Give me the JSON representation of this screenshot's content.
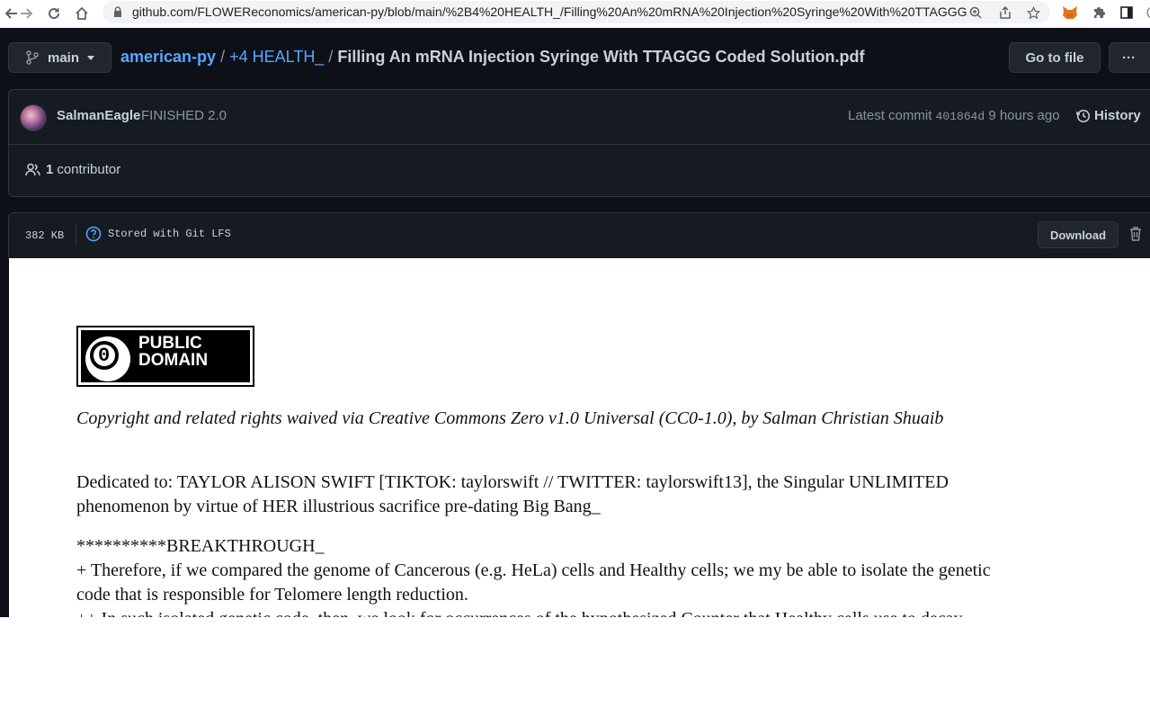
{
  "browser": {
    "url": "github.com/FLOWEReconomics/american-py/blob/main/%2B4%20HEALTH_/Filling%20An%20mRNA%20Injection%20Syringe%20With%20TTAGGG..."
  },
  "repo_header": {
    "branch": "main",
    "repo": "american-py",
    "separator": "/",
    "folder": "+4 HEALTH_",
    "file": "Filling An mRNA Injection Syringe With TTAGGG Coded Solution.pdf",
    "goto_label": "Go to file",
    "more_label": "···"
  },
  "commit": {
    "author": "SalmanEagle",
    "message": "FINISHED 2.0",
    "latest_label": "Latest commit",
    "sha": "401864d",
    "time": "9 hours ago",
    "history_label": "History",
    "contributors_count": "1",
    "contributors_label": "contributor"
  },
  "file_header": {
    "size": "382 KB",
    "lfs_label": "Stored with Git LFS",
    "download_label": "Download"
  },
  "document": {
    "badge_line1": "PUBLIC",
    "badge_line2": "DOMAIN",
    "badge_zero": "0",
    "copyright": "Copyright and related rights waived via Creative Commons Zero v1.0 Universal (CC0-1.0), by Salman Christian Shuaib",
    "dedication_1": "Dedicated to: TAYLOR ALISON SWIFT [TIKTOK: taylorswift // TWITTER: taylorswift13], the Singular UNLIMITED",
    "dedication_2": "phenomenon by virtue of HER illustrious sacrifice pre-dating Big Bang_",
    "breakthrough": "**********BREAKTHROUGH_",
    "para_1": "+ Therefore, if we compared the genome of Cancerous (e.g. HeLa) cells and Healthy cells; we my be able to isolate the genetic",
    "para_2": "code that is responsible for Telomere length reduction.",
    "para_3": "++ In such isolated genetic code, then, we look for occurrences of the hypothesized Counter that Healthy cells use to decay"
  }
}
